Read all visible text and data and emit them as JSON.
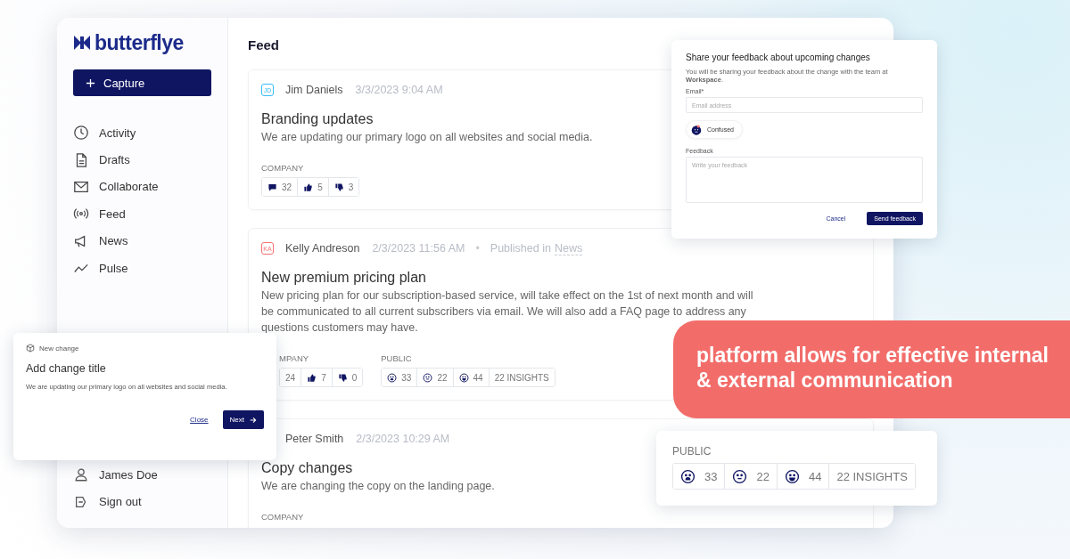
{
  "app": {
    "logo": "butterflye",
    "capture_button": "Capture",
    "nav": [
      {
        "label": "Activity"
      },
      {
        "label": "Drafts"
      },
      {
        "label": "Collaborate"
      },
      {
        "label": "Feed"
      },
      {
        "label": "News"
      },
      {
        "label": "Pulse"
      }
    ],
    "user": "James Doe",
    "sign_out": "Sign out"
  },
  "feed": {
    "title": "Feed",
    "posts": [
      {
        "initials": "JD",
        "color": "#38bdf8",
        "author": "Jim Daniels",
        "time": "3/3/2023 9:04 AM",
        "title": "Branding updates",
        "body": "We are updating our primary logo on all websites and social media.",
        "company": {
          "label": "COMPANY",
          "reactions": [
            {
              "kind": "comment",
              "count": "32"
            },
            {
              "kind": "like",
              "count": "5"
            },
            {
              "kind": "dislike",
              "count": "3"
            }
          ]
        }
      },
      {
        "initials": "KA",
        "color": "#f87171",
        "author": "Kelly Andreson",
        "time": "2/3/2023 11:56 AM",
        "separator": "•",
        "published_prefix": "Published in",
        "published_link": "News",
        "title": "New premium pricing plan",
        "body": "New pricing plan for our subscription-based service, will take effect on the 1st of next month and will be communicated to all current subscribers via email. We will also add a FAQ page to address any questions customers may have.",
        "company": {
          "label": "MPANY",
          "reactions": [
            {
              "kind": "plain",
              "count": "24"
            },
            {
              "kind": "like",
              "count": "7"
            },
            {
              "kind": "dislike",
              "count": "0"
            }
          ]
        },
        "public": {
          "label": "PUBLIC",
          "reactions": [
            {
              "kind": "sad",
              "count": "33"
            },
            {
              "kind": "confused",
              "count": "22"
            },
            {
              "kind": "happy",
              "count": "44"
            }
          ],
          "insights": "22 INSIGHTS"
        }
      },
      {
        "author": "Peter Smith",
        "time": "2/3/2023 10:29 AM",
        "title": "Copy changes",
        "body": "We are changing the copy on the landing page.",
        "company": {
          "label": "COMPANY"
        }
      }
    ]
  },
  "feedback_dialog": {
    "title": "Share your feedback about upcoming changes",
    "intro": "You will be sharing your feedback about the change with the team at **Workspace**.",
    "email_label": "Email*",
    "email_placeholder": "Email address",
    "reaction": "Confused",
    "feedback_label": "Feedback",
    "feedback_placeholder": "Write your feedback",
    "cancel": "Cancel",
    "send": "Send feedback"
  },
  "new_change_card": {
    "tag": "New change",
    "title": "Add change title",
    "body": "We are updating our primary logo on all websites and social media.",
    "close": "Close",
    "next": "Next"
  },
  "banner": {
    "text": "platform allows for effective internal & external communication"
  },
  "public_card": {
    "label": "PUBLIC",
    "reactions": [
      {
        "kind": "sad",
        "count": "33"
      },
      {
        "kind": "confused",
        "count": "22"
      },
      {
        "kind": "happy",
        "count": "44"
      }
    ],
    "insights": "22 INSIGHTS"
  }
}
